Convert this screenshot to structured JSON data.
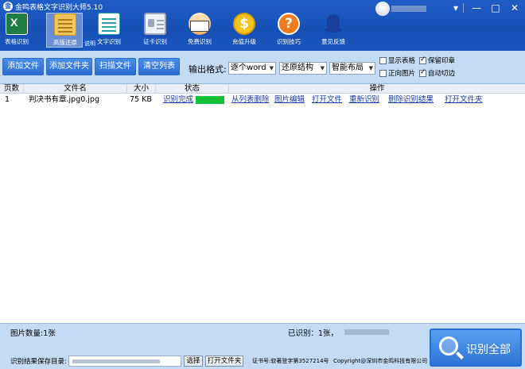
{
  "window": {
    "title": "金鸣表格文字识别大师5.10",
    "controls": {
      "menu": "▾",
      "minimize": "—",
      "maximize": "□",
      "close": "✕"
    }
  },
  "toolbar": {
    "excel": "表格识别",
    "restore": "高版还原",
    "restore_note": "说明",
    "text": "文字识别",
    "id_card": "证卡识别",
    "free": "免费识别",
    "upgrade": "充值升级",
    "upgrade_symbol": "$",
    "tips": "识别技巧",
    "tips_symbol": "?",
    "feedback": "意见反馈"
  },
  "actions": {
    "add_file": "添加文件",
    "add_folder": "添加文件夹",
    "scan": "扫描文件",
    "clear": "清空列表",
    "format_label": "输出格式:",
    "select_word": "逐个word",
    "select_struct": "还原结构",
    "select_layout": "智能布局",
    "chk_show_table": "显示表格",
    "chk_orient": "正向图片",
    "chk_seal": "保留印章",
    "chk_crop": "自动切边"
  },
  "table": {
    "headers": {
      "page": "页数",
      "name": "文件名",
      "size": "大小",
      "status": "状态",
      "ops": "操作"
    },
    "rows": [
      {
        "page": "1",
        "name": "判决书有章.jpg0.jpg",
        "size": "75 KB",
        "status": "识别完成",
        "progress": 1.0,
        "ops": {
          "remove": "从列表删除",
          "edit": "图片编辑",
          "open": "打开文件",
          "rerun": "重新识别",
          "delete": "删除识别结果",
          "folder": "打开文件夹"
        }
      }
    ]
  },
  "footer": {
    "image_count": "图片数量:1张",
    "recognized": "已识别：1张，",
    "save_label": "识别结果保存目录:",
    "select": "选择",
    "open_folder": "打开文件夹",
    "cert": "证书号:软著登字第3527214号",
    "copyright": "Copyright@深圳市金鸣科技有限公司",
    "recognize_all": "识别全部"
  },
  "colors": {
    "header_blue": "#1a56be",
    "panel_blue": "#c4dbf6",
    "button_blue": "#2c6cd0",
    "progress_green": "#11c23a",
    "link_blue": "#1a3aa8"
  }
}
